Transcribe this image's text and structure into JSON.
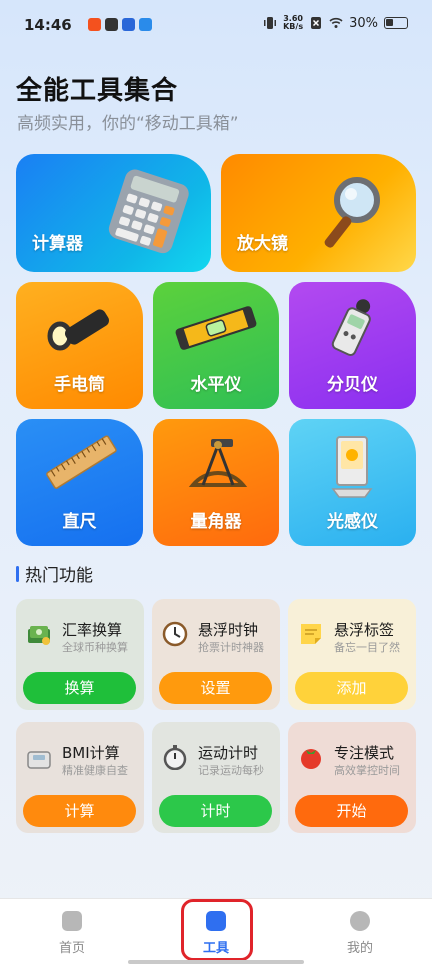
{
  "status": {
    "time": "14:46",
    "speed_value": "3.60",
    "speed_unit": "KB/s",
    "battery": "30%"
  },
  "header": {
    "title": "全能工具集合",
    "subtitle": "高频实用，你的“移动工具箱”"
  },
  "tools": [
    {
      "label": "计算器",
      "icon": "calculator-icon"
    },
    {
      "label": "放大镜",
      "icon": "magnifier-icon"
    },
    {
      "label": "手电筒",
      "icon": "flashlight-icon"
    },
    {
      "label": "水平仪",
      "icon": "level-icon"
    },
    {
      "label": "分贝仪",
      "icon": "decibel-meter-icon"
    },
    {
      "label": "直尺",
      "icon": "ruler-icon"
    },
    {
      "label": "量角器",
      "icon": "sextant-icon"
    },
    {
      "label": "光感仪",
      "icon": "light-meter-icon"
    }
  ],
  "hot": {
    "title": "热门功能",
    "cards": [
      {
        "name": "汇率换算",
        "desc": "全球币种换算",
        "button": "换算",
        "icon": "money-icon",
        "button_color": "#1fbf3a"
      },
      {
        "name": "悬浮时钟",
        "desc": "抢票计时神器",
        "button": "设置",
        "icon": "clock-icon",
        "button_color": "#ff9a0d"
      },
      {
        "name": "悬浮标签",
        "desc": "备忘一目了然",
        "button": "添加",
        "icon": "sticky-note-icon",
        "button_color": "#ffd23a"
      },
      {
        "name": "BMI计算",
        "desc": "精准健康自查",
        "button": "计算",
        "icon": "scale-icon",
        "button_color": "#ff8a0d"
      },
      {
        "name": "运动计时",
        "desc": "记录运动每秒",
        "button": "计时",
        "icon": "stopwatch-icon",
        "button_color": "#2cc84a"
      },
      {
        "name": "专注模式",
        "desc": "高效掌控时间",
        "button": "开始",
        "icon": "tomato-icon",
        "button_color": "#ff6a0d"
      }
    ]
  },
  "nav": {
    "items": [
      {
        "label": "首页",
        "icon": "lock-icon"
      },
      {
        "label": "工具",
        "icon": "toolbox-icon"
      },
      {
        "label": "我的",
        "icon": "profile-icon"
      }
    ]
  }
}
